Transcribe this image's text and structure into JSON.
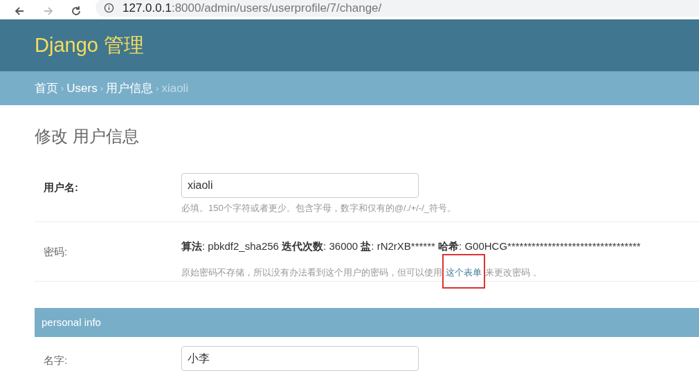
{
  "browser": {
    "url_host": "127.0.0.1",
    "url_path": ":8000/admin/users/userprofile/7/change/",
    "forward_disabled": true
  },
  "header": {
    "title": "Django 管理"
  },
  "breadcrumb_separator": "›",
  "breadcrumbs": [
    {
      "label": "首页",
      "current": false
    },
    {
      "label": "Users",
      "current": false
    },
    {
      "label": "用户信息",
      "current": false
    },
    {
      "label": "xiaoli",
      "current": true
    }
  ],
  "page_title": "修改 用户信息",
  "fields": [
    {
      "kind": "input",
      "label": "用户名:",
      "required": true,
      "value": "xiaoli",
      "help": "必填。150个字符或者更少。包含字母，数字和仅有的@/./+/-/_符号。"
    },
    {
      "kind": "password",
      "label": "密码:",
      "required": false,
      "summary": [
        {
          "label": "算法",
          "value": ": pbkdf2_sha256"
        },
        {
          "label": "迭代次数",
          "value": ": 36000"
        },
        {
          "label": "盐",
          "value": ": rN2rXB******"
        },
        {
          "label": "哈希",
          "value": ": G00HCG*********************************"
        }
      ],
      "help_before": "原始密码不存储，所以没有办法看到这个用户的密码，但可以使用",
      "help_link": "这个表单",
      "help_after": "来更改密码 。"
    }
  ],
  "fieldset": {
    "title": "personal info",
    "fields": [
      {
        "kind": "input",
        "label": "名字:",
        "required": false,
        "value": "小李"
      }
    ]
  }
}
